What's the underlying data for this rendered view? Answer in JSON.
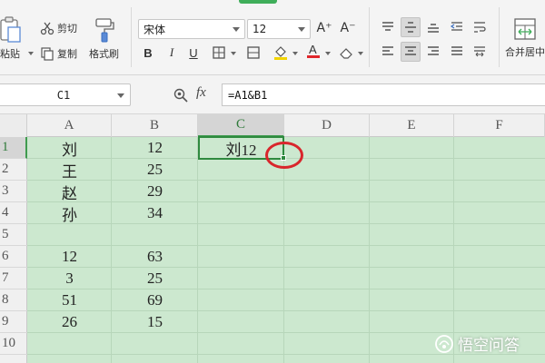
{
  "ribbon": {
    "clipboard": {
      "paste_label": "粘贴",
      "cut_label": "剪切",
      "copy_label": "复制",
      "format_painter_label": "格式刷"
    },
    "font": {
      "font_name": "宋体",
      "font_size": "12",
      "bold_label": "B",
      "italic_label": "I",
      "underline_label": "U",
      "increase_font_label": "A⁺",
      "decrease_font_label": "A⁻"
    },
    "alignment": {
      "merge_label": "合并居中"
    },
    "accent_color": "#3fae5a"
  },
  "formula_bar": {
    "name_box": "C1",
    "zoom_icon": "zoom-icon",
    "fx_label": "fx",
    "formula": "=A1&B1"
  },
  "sheet": {
    "columns": [
      "A",
      "B",
      "C",
      "D",
      "E",
      "F"
    ],
    "active_column": "C",
    "rows": [
      "1",
      "2",
      "3",
      "4",
      "5",
      "6",
      "7",
      "8",
      "9",
      "10"
    ],
    "active_row": "1",
    "col_a": [
      "刘",
      "王",
      "赵",
      "孙",
      "",
      "12",
      "3",
      "51",
      "26",
      ""
    ],
    "col_b": [
      "12",
      "25",
      "29",
      "34",
      "",
      "63",
      "25",
      "69",
      "15",
      ""
    ],
    "selected_cell_value": "刘12",
    "cell_bg_color": "#cce8cf",
    "highlight_color": "#d9262c"
  },
  "watermark": {
    "text": "悟空问答"
  }
}
